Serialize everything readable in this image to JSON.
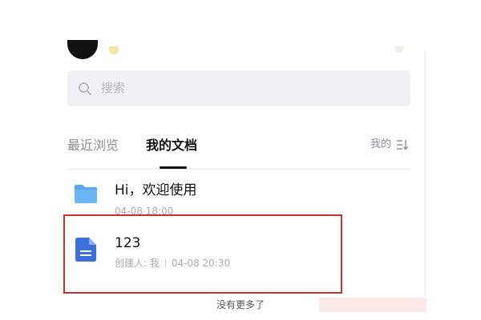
{
  "search": {
    "placeholder": "搜索"
  },
  "tabs": [
    {
      "label": "最近浏览",
      "active": false
    },
    {
      "label": "我的文档",
      "active": true
    }
  ],
  "sort": {
    "label": "我的"
  },
  "documents": [
    {
      "icon": "folder-icon",
      "title": "Hi，欢迎使用",
      "meta": "04-08 18:00"
    },
    {
      "icon": "doc-icon",
      "title": "123",
      "creator": "创建人: 我",
      "meta": "04-08 20:30"
    }
  ],
  "footer": {
    "text": "没有更多了"
  },
  "colors": {
    "folder": "#5aa9f0",
    "doc": "#3b6fd9",
    "highlight": "#cc3030",
    "search_bg": "#f0f1f4"
  }
}
